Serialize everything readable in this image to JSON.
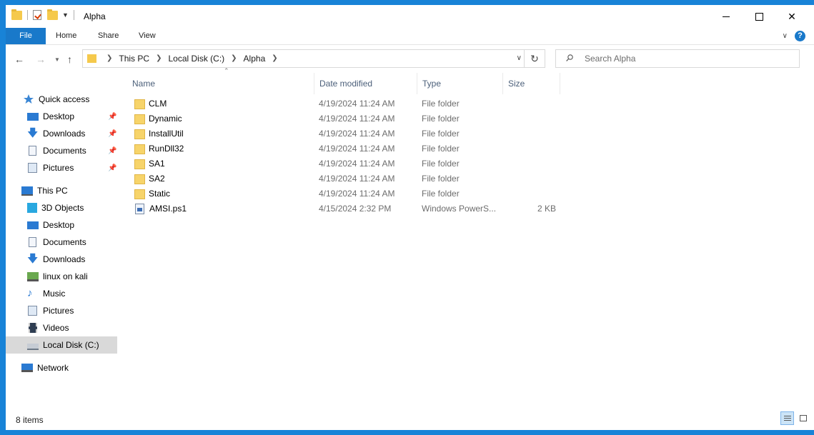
{
  "window": {
    "title": "Alpha"
  },
  "ribbon": {
    "file": "File",
    "home": "Home",
    "share": "Share",
    "view": "View"
  },
  "address": {
    "crumbs": [
      "This PC",
      "Local Disk (C:)",
      "Alpha"
    ]
  },
  "search": {
    "placeholder": "Search Alpha"
  },
  "navpane": {
    "quick_access": "Quick access",
    "quick_items": [
      "Desktop",
      "Downloads",
      "Documents",
      "Pictures"
    ],
    "this_pc": "This PC",
    "pc_items": [
      "3D Objects",
      "Desktop",
      "Documents",
      "Downloads",
      "linux on kali",
      "Music",
      "Pictures",
      "Videos",
      "Local Disk (C:)"
    ],
    "network": "Network"
  },
  "columns": {
    "name": "Name",
    "date": "Date modified",
    "type": "Type",
    "size": "Size"
  },
  "files": [
    {
      "name": "CLM",
      "date": "4/19/2024 11:24 AM",
      "type": "File folder",
      "size": ""
    },
    {
      "name": "Dynamic",
      "date": "4/19/2024 11:24 AM",
      "type": "File folder",
      "size": ""
    },
    {
      "name": "InstallUtil",
      "date": "4/19/2024 11:24 AM",
      "type": "File folder",
      "size": ""
    },
    {
      "name": "RunDll32",
      "date": "4/19/2024 11:24 AM",
      "type": "File folder",
      "size": ""
    },
    {
      "name": "SA1",
      "date": "4/19/2024 11:24 AM",
      "type": "File folder",
      "size": ""
    },
    {
      "name": "SA2",
      "date": "4/19/2024 11:24 AM",
      "type": "File folder",
      "size": ""
    },
    {
      "name": "Static",
      "date": "4/19/2024 11:24 AM",
      "type": "File folder",
      "size": ""
    },
    {
      "name": "AMSI.ps1",
      "date": "4/15/2024 2:32 PM",
      "type": "Windows PowerS...",
      "size": "2 KB"
    }
  ],
  "status": {
    "items": "8 items"
  },
  "colors": {
    "accent": "#1979ca",
    "desktop": "#1883d7",
    "folder": "#f7d46a",
    "selected": "#d9d9d9"
  }
}
